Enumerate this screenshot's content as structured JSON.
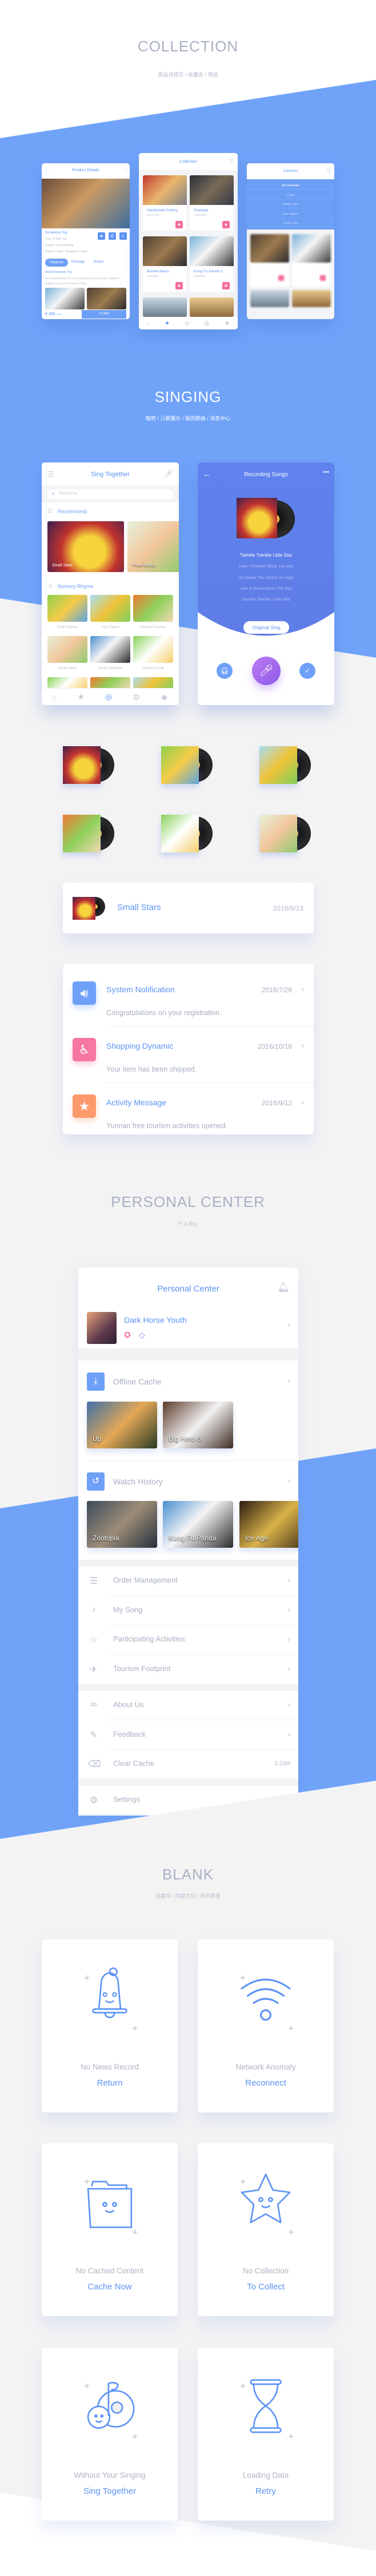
{
  "colors": {
    "accent": "#5b93f5",
    "background_blue": "#70a3f8",
    "pink": "#f56d9b",
    "orange": "#fd9a6c",
    "purple": "#a86bf0",
    "grey_text": "#a8b0c0"
  },
  "collection": {
    "title": "COLLECTION",
    "subtitle": "商品详情页  /  收藏夹  /  筛选",
    "product": {
      "title": "Product Details",
      "name": "Doraemon Toy",
      "price": "Price: ¥ 268 / Set",
      "freight": "Freight: Free Shipping",
      "delivery": "Delivery Place: Hangzhou, China",
      "tabs": [
        "Features",
        "Package",
        "Notice"
      ],
      "about_title": "About Doraemon Toy",
      "about_text": "Fine workmanship, the use of imported green material, suitable for children more than 6 months of play.",
      "total_price": "¥ 268",
      "total_unit": "/ Set",
      "pay_label": "TO PAY",
      "action_icons": [
        "star-icon",
        "phone-icon",
        "shield-icon"
      ]
    },
    "favorites": {
      "title": "Collection",
      "items": [
        {
          "title": "Handmade Pottery",
          "date": "2016/10/22"
        },
        {
          "title": "Zootopia",
          "date": "2016/10/18"
        },
        {
          "title": "Boonie Bears",
          "date": "2016/10/8"
        },
        {
          "title": "Kung Fu Panda 3",
          "date": "2016/9/26"
        }
      ]
    },
    "filter": {
      "title": "Collection",
      "options": [
        "All Collections",
        "Activity",
        "Children Video",
        "Sing Together",
        "Family Travel"
      ],
      "selected": "All Collections"
    },
    "tabbar_icons": [
      "home-icon",
      "star-icon",
      "target-icon",
      "planet-icon",
      "robot-icon"
    ],
    "active_tab": 1
  },
  "singing": {
    "title": "SINGING",
    "subtitle": "唱吧  /  儿歌展示  /  我的歌曲  /  消息中心",
    "home": {
      "title": "Sing Together",
      "search_placeholder": "Search for",
      "recommend_label": "Recommend",
      "recommend": [
        "Small Stars",
        "Three Monks"
      ],
      "nursery_label": "Nursery Rhyme",
      "nursery": [
        "Find Friends",
        "Two Tigers",
        "Harvest Carrots",
        "Good Mom",
        "Small Swallow",
        "School Song"
      ],
      "active_tab": 2
    },
    "recording": {
      "title": "Recording Songs",
      "lyrics": [
        "Twinkle Twinkle Little Star",
        "How I Wonder What You Are",
        "Up Above The World So High",
        "Like A Diamond In The Sky",
        "Twinkle Twinkle Little Star"
      ],
      "original_label": "Original Sing"
    },
    "song": {
      "title": "Small Stars",
      "date": "2016/9/13"
    },
    "messages": [
      {
        "title": "System Notification",
        "date": "2016/7/28",
        "text": "Congratulations on your registration.",
        "icon": "speaker-icon",
        "color": "#6fa0f7"
      },
      {
        "title": "Shopping Dynamic",
        "date": "2016/10/18",
        "text": "Your item has been shipped.",
        "icon": "stroller-icon",
        "color": "#f6779f"
      },
      {
        "title": "Activity Message",
        "date": "2016/9/12",
        "text": "Yunnan free tourism activities opened.",
        "icon": "star-icon",
        "color": "#fd9a6c"
      }
    ]
  },
  "personal": {
    "title": "PERSONAL CENTER",
    "subtitle": "个人中心",
    "header": "Personal Center",
    "user": {
      "name": "Dark Horse Youth",
      "badges": [
        "medal-icon",
        "diamond-icon"
      ]
    },
    "offline_label": "Offline Cache",
    "offline": [
      "Up",
      "Big Hero 6"
    ],
    "history_label": "Watch History",
    "history": [
      "Zootopia",
      "Kung Fu Panda",
      "Ice Age"
    ],
    "menu_group1": [
      "Order Management",
      "My Song",
      "Participating Activities",
      "Tourism Footprint"
    ],
    "menu_group2": [
      "About Us",
      "Feedback",
      "Clear Cache"
    ],
    "cache_size": "5.23M",
    "settings": "Settings"
  },
  "blank": {
    "title": "BLANK",
    "subtitle": "加载中  /  内容为空  /  访问异常",
    "cards": [
      {
        "label": "No News Record",
        "action": "Return",
        "icon": "bell-icon"
      },
      {
        "label": "Network Anomaly",
        "action": "Reconnect",
        "icon": "wifi-icon"
      },
      {
        "label": "No Cached Content",
        "action": "Cache Now",
        "icon": "folder-icon"
      },
      {
        "label": "No Collection",
        "action": "To Collect",
        "icon": "star-icon"
      },
      {
        "label": "Without Your Singing",
        "action": "Sing Together",
        "icon": "music-note-icon"
      },
      {
        "label": "Loading Data",
        "action": "Retry",
        "icon": "hourglass-icon"
      }
    ]
  }
}
